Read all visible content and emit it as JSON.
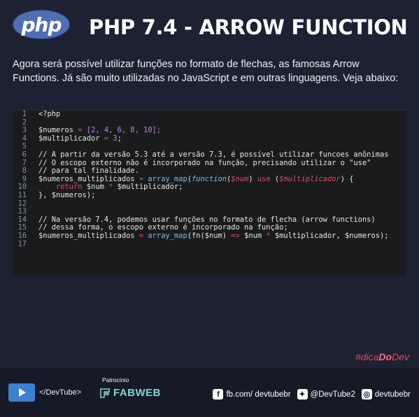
{
  "header": {
    "logo_text": "php",
    "title": "PHP 7.4 - ARROW FUNCTION"
  },
  "intro": "Agora será possível utilizar funções no formato de flechas, as famosas Arrow Functions. Já são muito utilizadas no JavaScript e em outras linguagens. Veja abaixo:",
  "code_lines": [
    "1",
    "2",
    "3",
    "4",
    "5",
    "6",
    "7",
    "8",
    "9",
    "10",
    "11",
    "12",
    "13",
    "14",
    "15",
    "16",
    "17"
  ],
  "code": {
    "l1": "<?php",
    "l3_var": "$numeros",
    "l3_eq": " = ",
    "l3_val": "[2, 4, 6, 8, 10];",
    "l4_var": "$multiplicador",
    "l4_eq": " = ",
    "l4_val": "3",
    "l4_end": ";",
    "l6": "// A partir da versão 5.3 até a versão 7.3, é possível utilizar funcoes anônimas",
    "l7": "// O escopo externo não é incorporado na função, precisando utilizar o \"use\"",
    "l8": "// para tal finalidade.",
    "l9_var": "$numeros_multiplicados",
    "l9_eq": " = ",
    "l9_fn": "array_map",
    "l9_p1": "(",
    "l9_kw": "function",
    "l9_p2": "(",
    "l9_arg": "$num",
    "l9_p3": ") ",
    "l9_use": "use",
    "l9_p4": " (",
    "l9_arg2": "$multiplicador",
    "l9_p5": ") {",
    "l10_kw": "return",
    "l10_rest1": " $num ",
    "l10_op": "*",
    "l10_rest2": " $multiplicador;",
    "l11": "}, $numeros);",
    "l14": "// Na versão 7.4, podemos usar funções no formato de flecha (arrow functions)",
    "l15": "// dessa forma, o escopo externo é incorporado na função;",
    "l16_var": "$numeros_multiplicados",
    "l16_eq": " = ",
    "l16_fn": "array_map",
    "l16_p1": "(fn($num) ",
    "l16_arrow": "=>",
    "l16_p2": " $num ",
    "l16_op": "*",
    "l16_p3": " $multiplicador, $numeros);"
  },
  "hashtag": {
    "pre": "#dica",
    "bold": "Do",
    "post": "Dev"
  },
  "footer": {
    "devtube": "</DevTube>",
    "sponsor_label": "Patrocínio",
    "sponsor": "FABWEB",
    "facebook": "fb.com/ devtubebr",
    "twitter": "@DevTube2",
    "instagram": "devtubebr"
  },
  "colors": {
    "background": "#1d2232",
    "code_bg": "#1a1b1c",
    "keyword": "#d94c6a",
    "function": "#7fb8e6",
    "number": "#b48ae6",
    "comment": "#6b7280",
    "hashtag": "#e8435a"
  }
}
